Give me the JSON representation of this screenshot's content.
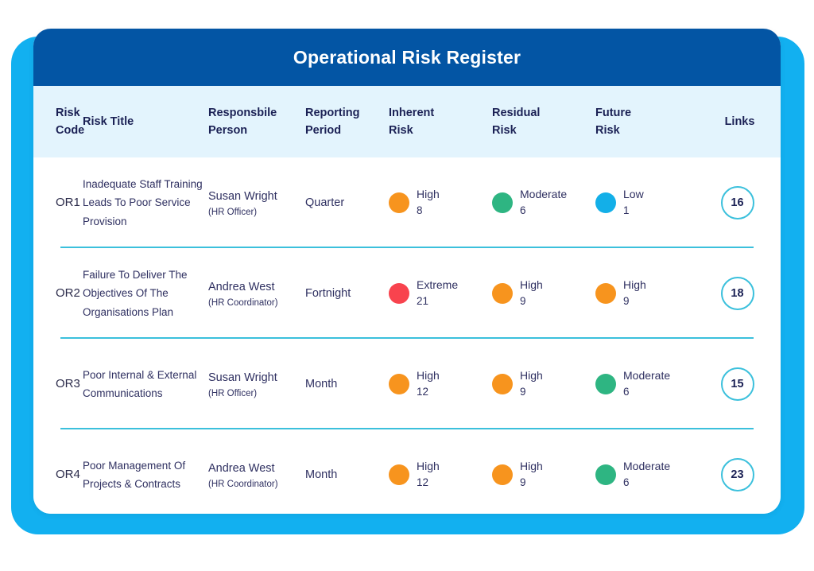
{
  "card": {
    "title": "Operational Risk Register",
    "title_bar_color": "#0355A4",
    "header_band_color": "#E3F4FD",
    "back_panel_color": "#12B0F0",
    "divider_color": "#3BC0DC"
  },
  "columns": [
    {
      "key": "risk_code",
      "line1": "Risk",
      "line2": "Code"
    },
    {
      "key": "risk_title",
      "line1": "Risk Title",
      "line2": ""
    },
    {
      "key": "person",
      "line1": "Responsbile",
      "line2": "Person"
    },
    {
      "key": "period",
      "line1": "Reporting",
      "line2": "Period"
    },
    {
      "key": "inherent",
      "line1": "Inherent",
      "line2": "Risk"
    },
    {
      "key": "residual",
      "line1": "Residual",
      "line2": "Risk"
    },
    {
      "key": "future",
      "line1": "Future",
      "line2": "Risk"
    },
    {
      "key": "links",
      "line1": "Links",
      "line2": ""
    }
  ],
  "legend_colors": {
    "Extreme": "#F8434E",
    "High": "#F7941E",
    "Moderate": "#2EB582",
    "Low": "#13AFE8"
  },
  "rows": [
    {
      "code": "OR1",
      "title": "Inadequate Staff Training Leads To Poor Service Provision",
      "person_name": "Susan Wright",
      "person_role": "(HR Officer)",
      "period": "Quarter",
      "inherent": {
        "label": "High",
        "value": "8",
        "color": "#F7941E"
      },
      "residual": {
        "label": "Moderate",
        "value": "6",
        "color": "#2EB582"
      },
      "future": {
        "label": "Low",
        "value": "1",
        "color": "#13AFE8"
      },
      "links": "16"
    },
    {
      "code": "OR2",
      "title": "Failure To Deliver The Objectives Of The Organisations Plan",
      "person_name": "Andrea West",
      "person_role": "(HR Coordinator)",
      "period": "Fortnight",
      "inherent": {
        "label": "Extreme",
        "value": "21",
        "color": "#F8434E"
      },
      "residual": {
        "label": "High",
        "value": "9",
        "color": "#F7941E"
      },
      "future": {
        "label": "High",
        "value": "9",
        "color": "#F7941E"
      },
      "links": "18"
    },
    {
      "code": "OR3",
      "title": "Poor Internal & External Communications",
      "person_name": "Susan Wright",
      "person_role": "(HR Officer)",
      "period": "Month",
      "inherent": {
        "label": "High",
        "value": "12",
        "color": "#F7941E"
      },
      "residual": {
        "label": "High",
        "value": "9",
        "color": "#F7941E"
      },
      "future": {
        "label": "Moderate",
        "value": "6",
        "color": "#2EB582"
      },
      "links": "15"
    },
    {
      "code": "OR4",
      "title": "Poor Management Of Projects & Contracts",
      "person_name": "Andrea West",
      "person_role": "(HR Coordinator)",
      "period": "Month",
      "inherent": {
        "label": "High",
        "value": "12",
        "color": "#F7941E"
      },
      "residual": {
        "label": "High",
        "value": "9",
        "color": "#F7941E"
      },
      "future": {
        "label": "Moderate",
        "value": "6",
        "color": "#2EB582"
      },
      "links": "23"
    }
  ]
}
